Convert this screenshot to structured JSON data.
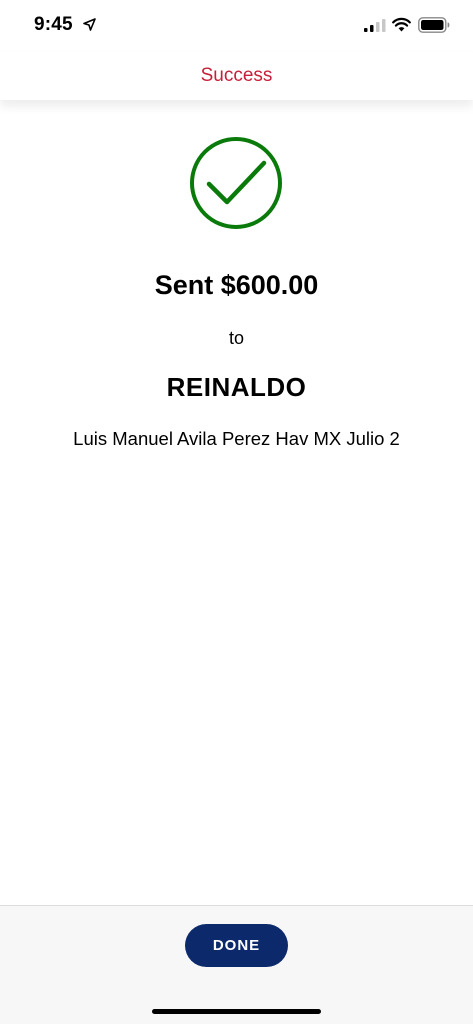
{
  "status_bar": {
    "time": "9:45",
    "icons": [
      "location-arrow-icon",
      "cellular-signal-icon",
      "wifi-icon",
      "battery-icon"
    ]
  },
  "header": {
    "title": "Success",
    "title_color": "#c8203a"
  },
  "confirmation": {
    "icon": "checkmark-circle-icon",
    "icon_color": "#0a7a0a",
    "sent_text": "Sent $600.00",
    "to_text": "to",
    "recipient": "REINALDO",
    "memo": "Luis Manuel Avila Perez Hav MX Julio 2"
  },
  "footer": {
    "done_label": "DONE",
    "done_color": "#0c2a6b"
  }
}
